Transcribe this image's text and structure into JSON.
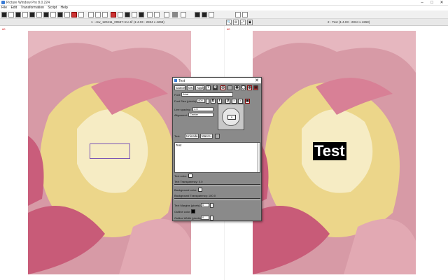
{
  "window": {
    "title": "Picture Window Pro 8.0.224"
  },
  "menu": [
    "File",
    "Edit",
    "Transformation",
    "Script",
    "Help"
  ],
  "panes": {
    "left": {
      "index": "#0",
      "caption": "1 - crw_120411_00597+2.e.tif (1:4.03 - 2834 x 4268)"
    },
    "right": {
      "index": "#0",
      "caption": "2 - Text (1:4.03 - 2834 x 4268)"
    }
  },
  "overlay_text": "Test",
  "dialog": {
    "title": "Text",
    "buttons": {
      "cancel": "Cancel",
      "ok": "OK",
      "apply": "Apply",
      "help": "?"
    },
    "font_label": "Font:",
    "font_value": "Arial",
    "font_size_label": "Font Size (pixels):",
    "font_size_value": "400",
    "line_spacing_label": "Line spacing:",
    "line_spacing_value": "1.0",
    "alignment_label": "Alignment:",
    "alignment_value": "Center",
    "angle_value": "0",
    "style_bold": "B",
    "style_italic": "I",
    "style_d": "D",
    "text_label": "Text:",
    "unicode_label": "Unicode...",
    "macro_label": "Macro...",
    "text_value": "Test",
    "text_color_label": "Text color:",
    "text_transparency_label": "Text Transparency: 0.0",
    "bg_color_label": "Background color:",
    "bg_transparency_label": "Background Transparency: 100.0",
    "text_margins_label": "Text Margins (pixels):",
    "text_margins_value": "0",
    "outline_color_label": "Outline color:",
    "outline_width_label": "Outline Width (pixels):",
    "outline_width_value": "0"
  },
  "colors": {
    "text": "#ffffff",
    "background": "#ffffff",
    "outline": "#000000",
    "selection": "#7a55b5"
  }
}
